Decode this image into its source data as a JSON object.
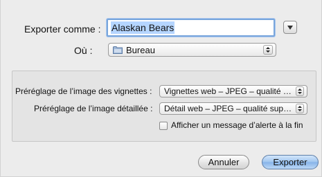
{
  "save_as": {
    "label": "Exporter comme :",
    "filename": "Alaskan Bears"
  },
  "location": {
    "label": "Où :",
    "selected": "Bureau",
    "icon": "folder-icon"
  },
  "options": {
    "thumbnail_preset": {
      "label": "Préréglage de l’image des vignettes :",
      "value": "Vignettes web – JPEG – qualité s…"
    },
    "detail_preset": {
      "label": "Préréglage de l’image détaillée :",
      "value": "Détail web – JPEG – qualité supé…"
    },
    "alert_checkbox": {
      "label": "Afficher un message d’alerte à la fin",
      "checked": false
    }
  },
  "buttons": {
    "cancel": "Annuler",
    "export": "Exporter"
  }
}
